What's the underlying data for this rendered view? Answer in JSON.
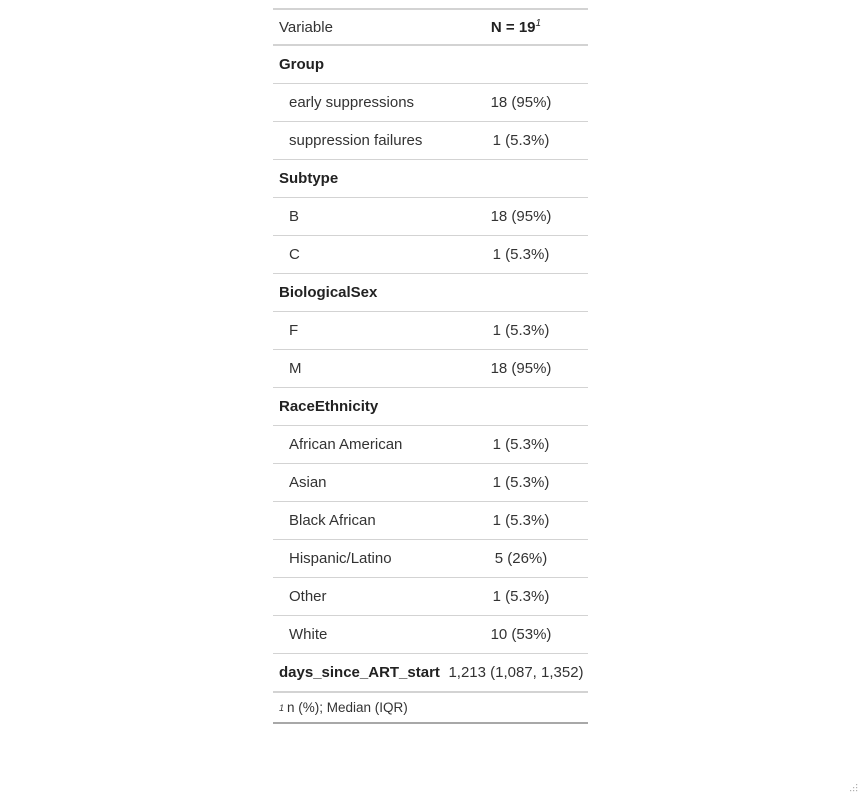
{
  "header": {
    "variable": "Variable",
    "n": "N = 19",
    "n_footnote_mark": "1"
  },
  "rows": [
    {
      "label": "Group",
      "value": "",
      "type": "head"
    },
    {
      "label": "early suppressions",
      "value": "18 (95%)",
      "type": "sub"
    },
    {
      "label": "suppression failures",
      "value": "1 (5.3%)",
      "type": "sub"
    },
    {
      "label": "Subtype",
      "value": "",
      "type": "head"
    },
    {
      "label": "B",
      "value": "18 (95%)",
      "type": "sub"
    },
    {
      "label": "C",
      "value": "1 (5.3%)",
      "type": "sub"
    },
    {
      "label": "BiologicalSex",
      "value": "",
      "type": "head"
    },
    {
      "label": "F",
      "value": "1 (5.3%)",
      "type": "sub"
    },
    {
      "label": "M",
      "value": "18 (95%)",
      "type": "sub"
    },
    {
      "label": "RaceEthnicity",
      "value": "",
      "type": "head"
    },
    {
      "label": "African American",
      "value": "1 (5.3%)",
      "type": "sub"
    },
    {
      "label": "Asian",
      "value": "1 (5.3%)",
      "type": "sub"
    },
    {
      "label": "Black African",
      "value": "1 (5.3%)",
      "type": "sub"
    },
    {
      "label": "Hispanic/Latino",
      "value": "5 (26%)",
      "type": "sub"
    },
    {
      "label": "Other",
      "value": "1 (5.3%)",
      "type": "sub"
    },
    {
      "label": "White",
      "value": "10 (53%)",
      "type": "sub"
    },
    {
      "label": "days_since_ART_start",
      "value": "1,213 (1,087, 1,352)",
      "type": "head"
    }
  ],
  "footnote": {
    "mark": "1",
    "text": "n (%); Median (IQR)"
  }
}
